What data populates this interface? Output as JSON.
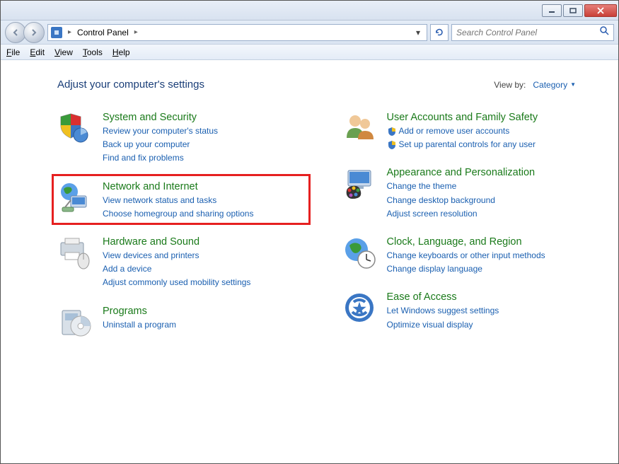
{
  "titlebar": {},
  "address": {
    "location": "Control Panel"
  },
  "search": {
    "placeholder": "Search Control Panel"
  },
  "menubar": {
    "file": "File",
    "edit": "Edit",
    "view": "View",
    "tools": "Tools",
    "help": "Help"
  },
  "heading": "Adjust your computer's settings",
  "viewby": {
    "label": "View by:",
    "value": "Category"
  },
  "cats": {
    "system": {
      "title": "System and Security",
      "l1": "Review your computer's status",
      "l2": "Back up your computer",
      "l3": "Find and fix problems"
    },
    "network": {
      "title": "Network and Internet",
      "l1": "View network status and tasks",
      "l2": "Choose homegroup and sharing options"
    },
    "hardware": {
      "title": "Hardware and Sound",
      "l1": "View devices and printers",
      "l2": "Add a device",
      "l3": "Adjust commonly used mobility settings"
    },
    "programs": {
      "title": "Programs",
      "l1": "Uninstall a program"
    },
    "users": {
      "title": "User Accounts and Family Safety",
      "l1": "Add or remove user accounts",
      "l2": "Set up parental controls for any user"
    },
    "appearance": {
      "title": "Appearance and Personalization",
      "l1": "Change the theme",
      "l2": "Change desktop background",
      "l3": "Adjust screen resolution"
    },
    "clock": {
      "title": "Clock, Language, and Region",
      "l1": "Change keyboards or other input methods",
      "l2": "Change display language"
    },
    "ease": {
      "title": "Ease of Access",
      "l1": "Let Windows suggest settings",
      "l2": "Optimize visual display"
    }
  }
}
